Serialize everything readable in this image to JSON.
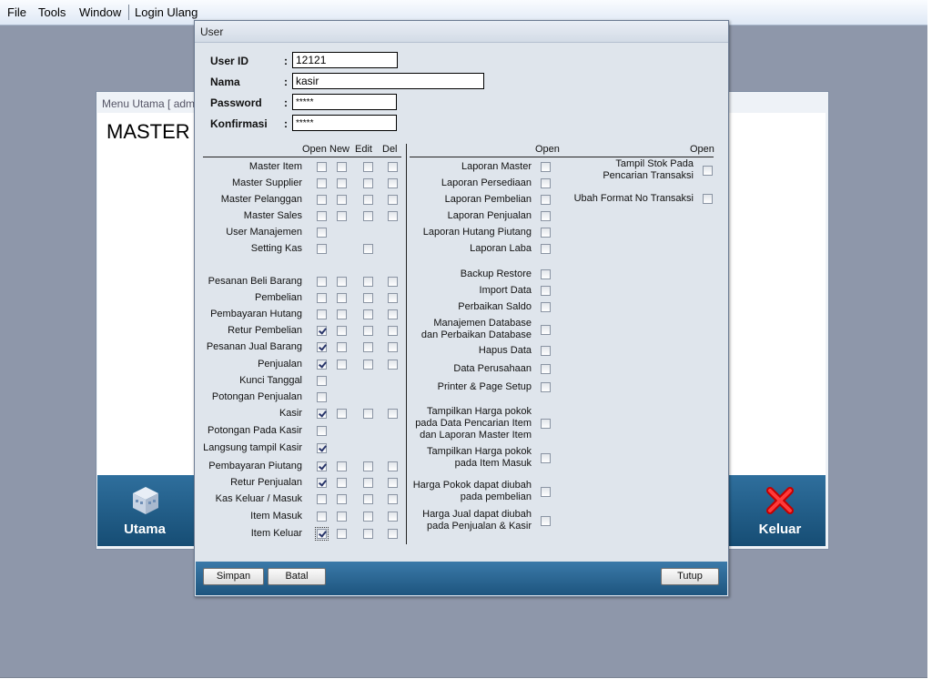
{
  "menubar": {
    "file": "File",
    "tools": "Tools",
    "window": "Window",
    "login_ulang": "Login Ulang"
  },
  "background_window": {
    "title": "Menu Utama [ adm",
    "heading": "MASTER D",
    "tile_left": {
      "label": "Utama",
      "icon": "building-icon"
    },
    "tile_right": {
      "label": "Keluar",
      "icon": "close-icon"
    }
  },
  "dialog": {
    "title": "User",
    "fields": {
      "user_id": {
        "label": "User ID",
        "value": "12121"
      },
      "nama": {
        "label": "Nama",
        "value": "kasir"
      },
      "password": {
        "label": "Password",
        "value": "*****"
      },
      "konfirmasi": {
        "label": "Konfirmasi",
        "value": "*****"
      },
      "colon": ":"
    },
    "headers": {
      "open": "Open",
      "new": "New",
      "edit": "Edit",
      "del": "Del",
      "mid_open": "Open",
      "right_open": "Open"
    },
    "left_perms": [
      {
        "label": "Master Item",
        "open": false,
        "new": false,
        "edit": false,
        "del": false
      },
      {
        "label": "Master Supplier",
        "open": false,
        "new": false,
        "edit": false,
        "del": false
      },
      {
        "label": "Master Pelanggan",
        "open": false,
        "new": false,
        "edit": false,
        "del": false
      },
      {
        "label": "Master Sales",
        "open": false,
        "new": false,
        "edit": false,
        "del": false
      },
      {
        "label": "User Manajemen",
        "open": false
      },
      {
        "label": "Setting Kas",
        "open": false,
        "edit": false
      },
      {
        "label": "Pesanan Beli Barang",
        "open": false,
        "new": false,
        "edit": false,
        "del": false
      },
      {
        "label": "Pembelian",
        "open": false,
        "new": false,
        "edit": false,
        "del": false
      },
      {
        "label": "Pembayaran Hutang",
        "open": false,
        "new": false,
        "edit": false,
        "del": false
      },
      {
        "label": "Retur Pembelian",
        "open": true,
        "new": false,
        "edit": false,
        "del": false
      },
      {
        "label": "Pesanan Jual Barang",
        "open": true,
        "new": false,
        "edit": false,
        "del": false
      },
      {
        "label": "Penjualan",
        "open": true,
        "new": false,
        "edit": false,
        "del": false
      },
      {
        "label": "Kunci Tanggal",
        "open": false
      },
      {
        "label": "Potongan Penjualan",
        "open": false
      },
      {
        "label": "Kasir",
        "open": true,
        "new": false,
        "edit": false,
        "del": false
      },
      {
        "label": "Potongan Pada Kasir",
        "open": false
      },
      {
        "label": "Langsung tampil Kasir",
        "open": true
      },
      {
        "label": "Pembayaran Piutang",
        "open": true,
        "new": false,
        "edit": false,
        "del": false
      },
      {
        "label": "Retur Penjualan",
        "open": true,
        "new": false,
        "edit": false,
        "del": false
      },
      {
        "label": "Kas Keluar / Masuk",
        "open": false,
        "new": false,
        "edit": false,
        "del": false
      },
      {
        "label": "Item Masuk",
        "open": false,
        "new": false,
        "edit": false,
        "del": false
      },
      {
        "label": "Item Keluar",
        "open": true,
        "new": false,
        "edit": false,
        "del": false
      }
    ],
    "mid_perms": [
      {
        "label": "Laporan Master",
        "open": false
      },
      {
        "label": "Laporan Persediaan",
        "open": false
      },
      {
        "label": "Laporan Pembelian",
        "open": false
      },
      {
        "label": "Laporan Penjualan",
        "open": false
      },
      {
        "label": "Laporan Hutang Piutang",
        "open": false
      },
      {
        "label": "Laporan Laba",
        "open": false
      },
      {
        "label": "Backup Restore",
        "open": false
      },
      {
        "label": "Import Data",
        "open": false
      },
      {
        "label": "Perbaikan Saldo",
        "open": false
      },
      {
        "label": "Manajemen Database",
        "label2": "dan Perbaikan Database",
        "open": false
      },
      {
        "label": "Hapus Data",
        "open": false
      },
      {
        "label": "Data Perusahaan",
        "open": false
      },
      {
        "label": "Printer & Page Setup",
        "open": false
      },
      {
        "label": "Tampilkan Harga pokok",
        "label2": "pada Data Pencarian Item",
        "label3": "dan Laporan Master Item",
        "open": false
      },
      {
        "label": "Tampilkan Harga pokok",
        "label2": "pada Item Masuk",
        "open": false
      },
      {
        "label": "Harga Pokok dapat diubah",
        "label2": "pada pembelian",
        "open": false
      },
      {
        "label": "Harga Jual dapat diubah",
        "label2": "pada Penjualan & Kasir",
        "open": false
      }
    ],
    "right_perms": [
      {
        "label": "Tampil Stok Pada",
        "label2": "Pencarian Transaksi",
        "open": false
      },
      {
        "label": "Ubah Format No Transaksi",
        "open": false
      }
    ],
    "buttons": {
      "simpan": "Simpan",
      "batal": "Batal",
      "tutup": "Tutup"
    }
  }
}
